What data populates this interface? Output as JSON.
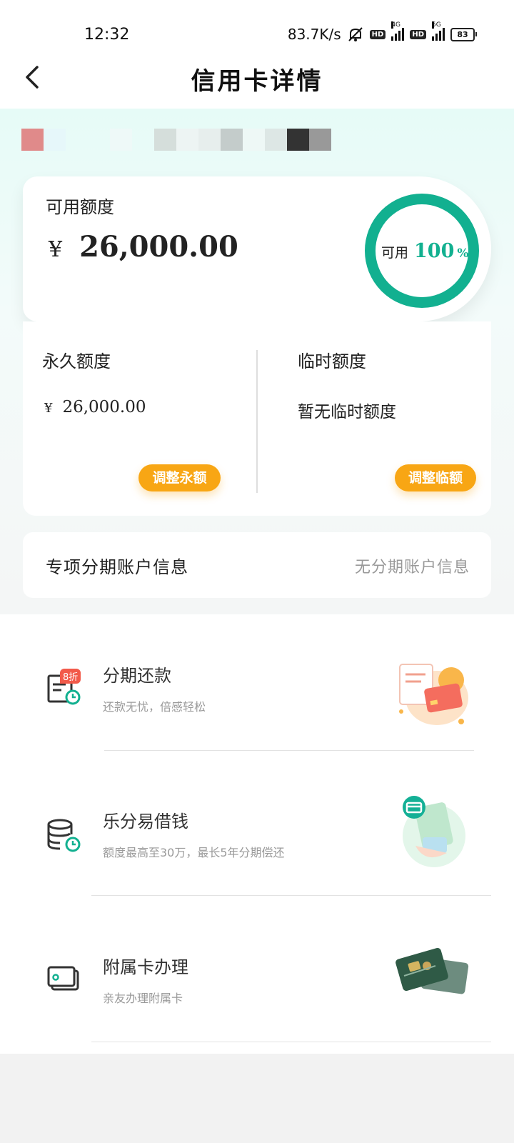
{
  "status_bar": {
    "time": "12:32",
    "speed": "83.7K/s",
    "hd_badge": "HD",
    "net_4g": "4G",
    "net_5g": "5G",
    "battery": "83"
  },
  "header": {
    "title": "信用卡详情"
  },
  "available": {
    "label": "可用额度",
    "currency": "¥",
    "amount": "26,000.00",
    "ring_label": "可用",
    "percent": "100",
    "percent_sign": "%",
    "percent_value": 1.0,
    "accent_color": "#12b090"
  },
  "permanent": {
    "label": "永久额度",
    "currency": "¥",
    "amount": "26,000.00",
    "button": "调整永额"
  },
  "temporary": {
    "label": "临时额度",
    "value": "暂无临时额度",
    "button": "调整临额"
  },
  "installment_account": {
    "label": "专项分期账户信息",
    "value": "无分期账户信息"
  },
  "services": [
    {
      "title": "分期还款",
      "subtitle": "还款无忧，倍感轻松",
      "icon": "bill-clock-icon",
      "badge": "8折"
    },
    {
      "title": "乐分易借钱",
      "subtitle": "额度最高至30万，最长5年分期偿还",
      "icon": "coins-clock-icon"
    },
    {
      "title": "附属卡办理",
      "subtitle": "亲友办理附属卡",
      "icon": "card-icon"
    }
  ],
  "colors": {
    "accent": "#12b090",
    "button": "#f8a614"
  }
}
